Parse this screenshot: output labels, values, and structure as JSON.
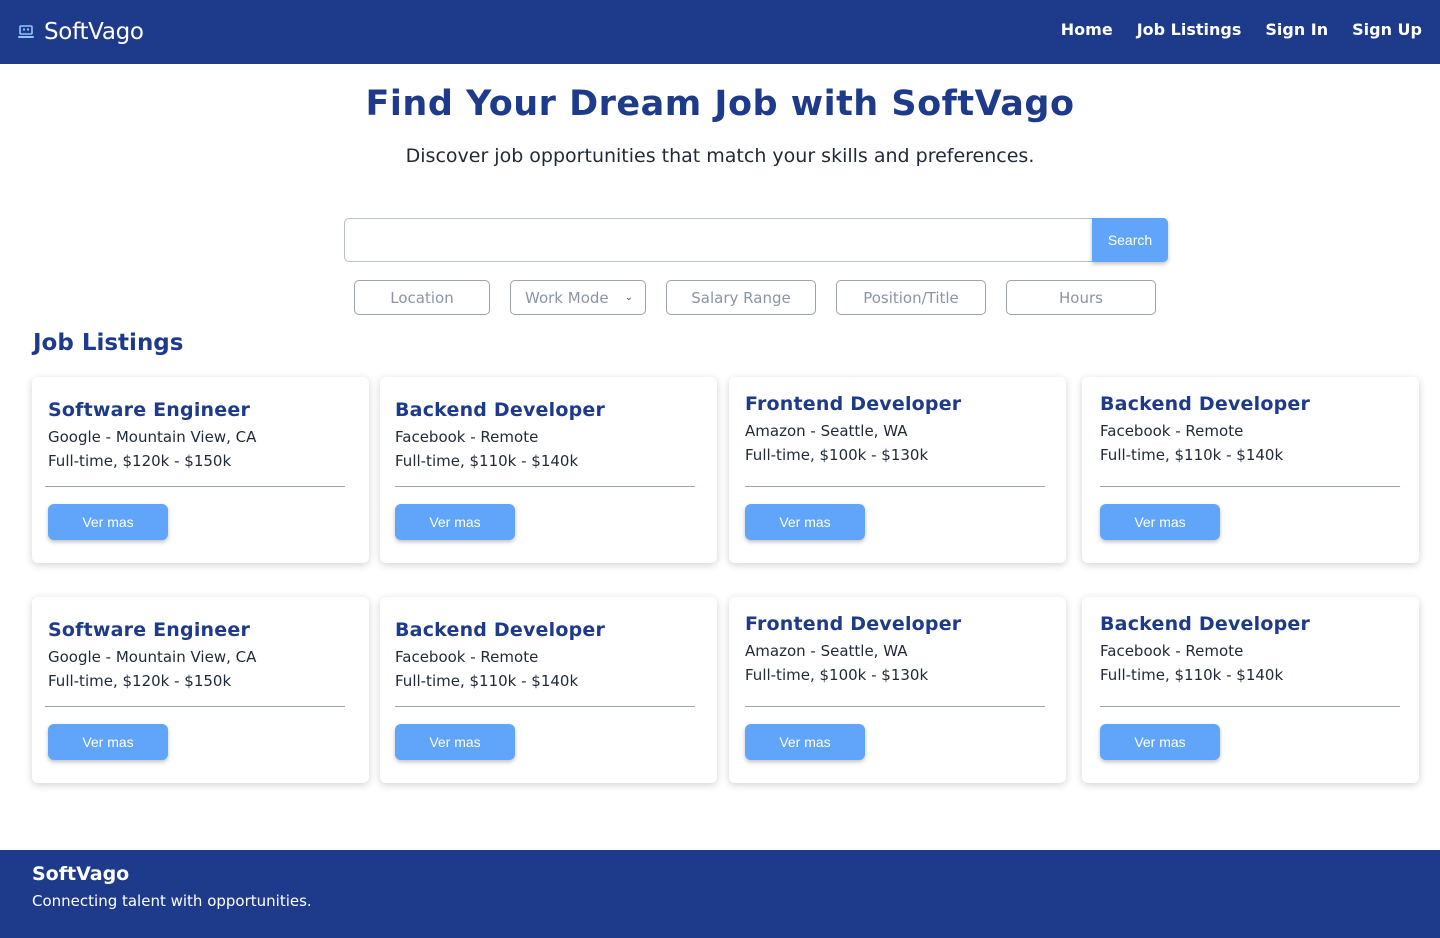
{
  "header": {
    "brand": "SoftVago",
    "nav": [
      "Home",
      "Job Listings",
      "Sign In",
      "Sign Up"
    ]
  },
  "hero": {
    "title": "Find Your Dream Job with SoftVago",
    "subtitle": "Discover job opportunities that match your skills and preferences."
  },
  "search": {
    "value": "",
    "placeholder": "",
    "button": "Search"
  },
  "filters": {
    "location": "Location",
    "work_mode": "Work Mode",
    "salary_range": "Salary Range",
    "position_title": "Position/Title",
    "hours": "Hours"
  },
  "listings": {
    "heading": "Job Listings",
    "button_label": "Ver mas",
    "jobs": [
      {
        "title": "Software Engineer",
        "company": "Google - Mountain View, CA",
        "terms": "Full-time, $120k - $150k"
      },
      {
        "title": "Backend Developer",
        "company": "Facebook - Remote",
        "terms": "Full-time, $110k - $140k"
      },
      {
        "title": "Frontend Developer",
        "company": "Amazon - Seattle, WA",
        "terms": "Full-time, $100k - $130k"
      },
      {
        "title": "Backend Developer",
        "company": "Facebook - Remote",
        "terms": "Full-time, $110k - $140k"
      },
      {
        "title": "Software Engineer",
        "company": "Google - Mountain View, CA",
        "terms": "Full-time, $120k - $150k"
      },
      {
        "title": "Backend Developer",
        "company": "Facebook - Remote",
        "terms": "Full-time, $110k - $140k"
      },
      {
        "title": "Frontend Developer",
        "company": "Amazon - Seattle, WA",
        "terms": "Full-time, $100k - $130k"
      },
      {
        "title": "Backend Developer",
        "company": "Facebook - Remote",
        "terms": "Full-time, $110k - $140k"
      }
    ]
  },
  "footer": {
    "brand": "SoftVago",
    "tagline": "Connecting talent with opportunities."
  },
  "colors": {
    "primary": "#1e3a8a",
    "accent": "#60a5fa",
    "text": "#1f2937",
    "muted": "#8b95a5"
  },
  "icons": {
    "brand": "laptop-icon",
    "work_mode_dropdown": "chevron-down-icon"
  }
}
